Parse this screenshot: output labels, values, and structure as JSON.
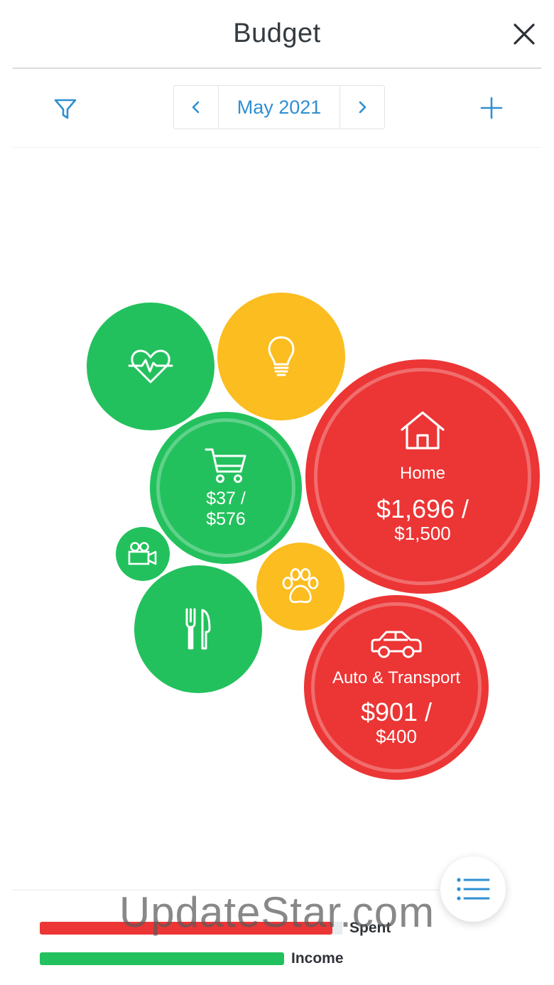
{
  "header": {
    "title": "Budget",
    "close_icon": "close-icon"
  },
  "toolbar": {
    "filter_icon": "filter-icon",
    "add_icon": "plus-icon",
    "month": "May 2021",
    "prev_icon": "chevron-left-icon",
    "next_icon": "chevron-right-icon"
  },
  "colors": {
    "accent": "#2f8fd1",
    "green": "#23c15d",
    "yellow": "#fbbd1f",
    "red": "#ec3535"
  },
  "bubbles": {
    "health": {
      "icon": "heart-pulse-icon",
      "status": "green"
    },
    "utilities": {
      "icon": "lightbulb-icon",
      "status": "yellow"
    },
    "groceries": {
      "icon": "shopping-cart-icon",
      "status": "green",
      "amount": "$37 /",
      "budget": "$576"
    },
    "home": {
      "icon": "house-icon",
      "status": "red",
      "name": "Home",
      "amount": "$1,696 /",
      "budget": "$1,500"
    },
    "entertainment": {
      "icon": "video-camera-icon",
      "status": "green"
    },
    "pets": {
      "icon": "paw-icon",
      "status": "yellow"
    },
    "food": {
      "icon": "fork-knife-icon",
      "status": "green"
    },
    "auto": {
      "icon": "car-icon",
      "status": "red",
      "name": "Auto & Transport",
      "amount": "$901 /",
      "budget": "$400"
    }
  },
  "legend": {
    "spent_label": "Spent",
    "income_label": "Income"
  },
  "fab_icon": "list-icon",
  "watermark": "UpdateStar.com"
}
